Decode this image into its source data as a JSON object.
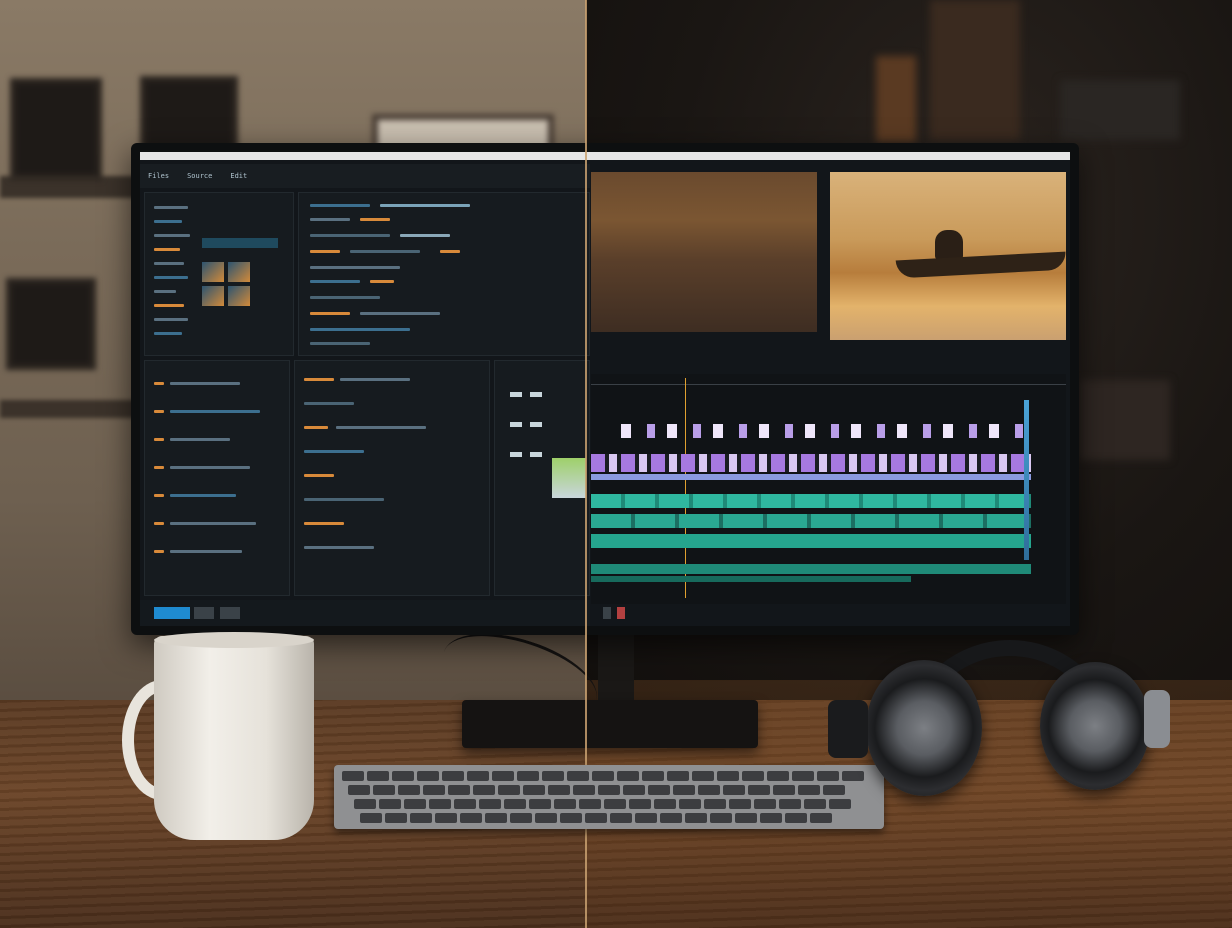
{
  "scene": {
    "description_free": true
  },
  "editor": {
    "tabs": [
      "Files",
      "Source",
      "Edit"
    ],
    "viewer_left_caption": "",
    "viewer_right_caption": ""
  },
  "colors": {
    "accent_orange": "#e0a030",
    "clip_purple": "#a679e0",
    "clip_teal": "#2fb8a0",
    "divider": "#c8a070"
  },
  "icons": [
    "menu-icon",
    "play-icon",
    "stop-icon",
    "record-icon"
  ]
}
